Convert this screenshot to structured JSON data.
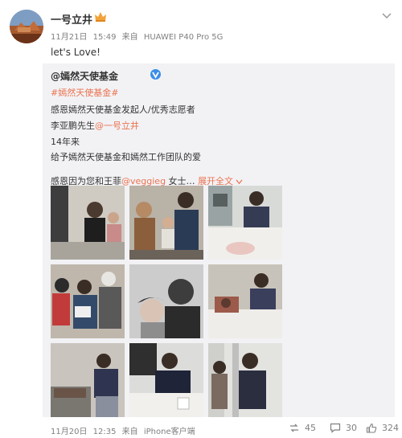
{
  "post": {
    "username": "一号立井",
    "date": "11月21日",
    "time": "15:49",
    "source_prefix": "来自",
    "source": "HUAWEI P40 Pro 5G",
    "text": "let's Love!"
  },
  "repost": {
    "author": "@嫣然天使基金",
    "topic": "#嫣然天使基金#",
    "line1": "感恩嫣然天使基金发起人/优秀志愿者",
    "line2_prefix": "李亚鹏先生",
    "line2_mention": "@一号立井",
    "line3": "14年来",
    "line4": "给予嫣然天使基金和嫣然工作团队的爱",
    "line5_prefix": "感恩因为您和王菲",
    "line5_mention": "@veggieg",
    "line5_suffix": " 女士…",
    "expand": "展开全文",
    "expand_icon": "chevron-down-icon",
    "date": "11月20日",
    "time": "12:35",
    "source_prefix": "来自",
    "source": "iPhone客户端",
    "stats": {
      "reposts": "45",
      "comments": "30",
      "likes": "324"
    }
  },
  "colors": {
    "link": "#eb7350",
    "meta": "#808080",
    "repost_bg": "#f2f2f5"
  }
}
